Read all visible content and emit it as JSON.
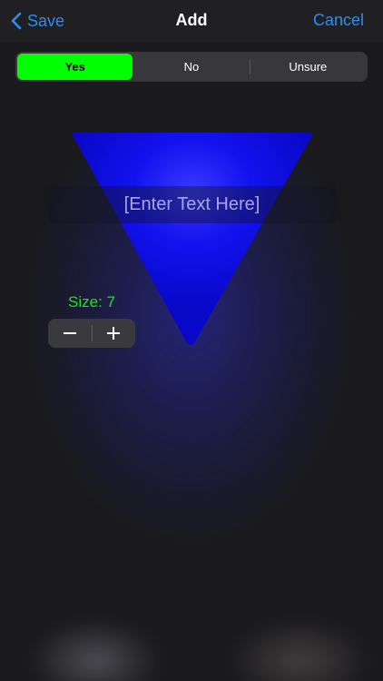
{
  "navbar": {
    "back_label": "Save",
    "title": "Add",
    "cancel_label": "Cancel",
    "accent_color": "#2f8cf0"
  },
  "segmented": {
    "options": [
      "Yes",
      "No",
      "Unsure"
    ],
    "selected": "Yes",
    "selected_color": "#00ff00"
  },
  "shape": {
    "type": "inverted-triangle",
    "color": "#0a0aff"
  },
  "text_field": {
    "placeholder": "[Enter Text Here]"
  },
  "size": {
    "label": "Size: 7",
    "value": 7,
    "decrement_icon": "minus-icon",
    "increment_icon": "plus-icon"
  }
}
